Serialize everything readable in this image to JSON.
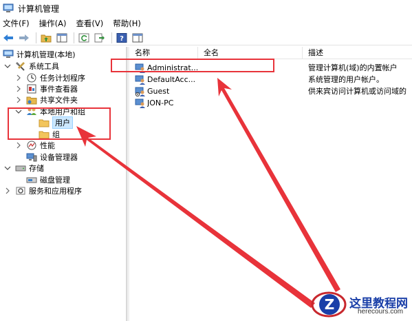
{
  "window": {
    "title": "计算机管理"
  },
  "menu": [
    "文件(F)",
    "操作(A)",
    "查看(V)",
    "帮助(H)"
  ],
  "tree": {
    "root": "计算机管理(本地)",
    "system_tools": "系统工具",
    "task_scheduler": "任务计划程序",
    "event_viewer": "事件查看器",
    "shared_folders": "共享文件夹",
    "local_users_groups": "本地用户和组",
    "users": "用户",
    "groups": "组",
    "performance": "性能",
    "device_manager": "设备管理器",
    "storage": "存储",
    "disk_management": "磁盘管理",
    "services_apps": "服务和应用程序"
  },
  "list": {
    "columns": [
      "名称",
      "全名",
      "描述"
    ],
    "rows": [
      {
        "name": "Administrat...",
        "fullname": "",
        "desc": "管理计算机(域)的内置帐户"
      },
      {
        "name": "DefaultAcc...",
        "fullname": "",
        "desc": "系统管理的用户帐户。"
      },
      {
        "name": "Guest",
        "fullname": "",
        "desc": "供来宾访问计算机或访问域的"
      },
      {
        "name": "JON-PC",
        "fullname": "",
        "desc": ""
      }
    ]
  },
  "watermark": {
    "title": "这里教程网",
    "url": "herecours.com",
    "logo_letter": "Z"
  },
  "colors": {
    "annotation": "#e8333a",
    "selection": "#cce8ff",
    "accent": "#1a3fa8"
  }
}
